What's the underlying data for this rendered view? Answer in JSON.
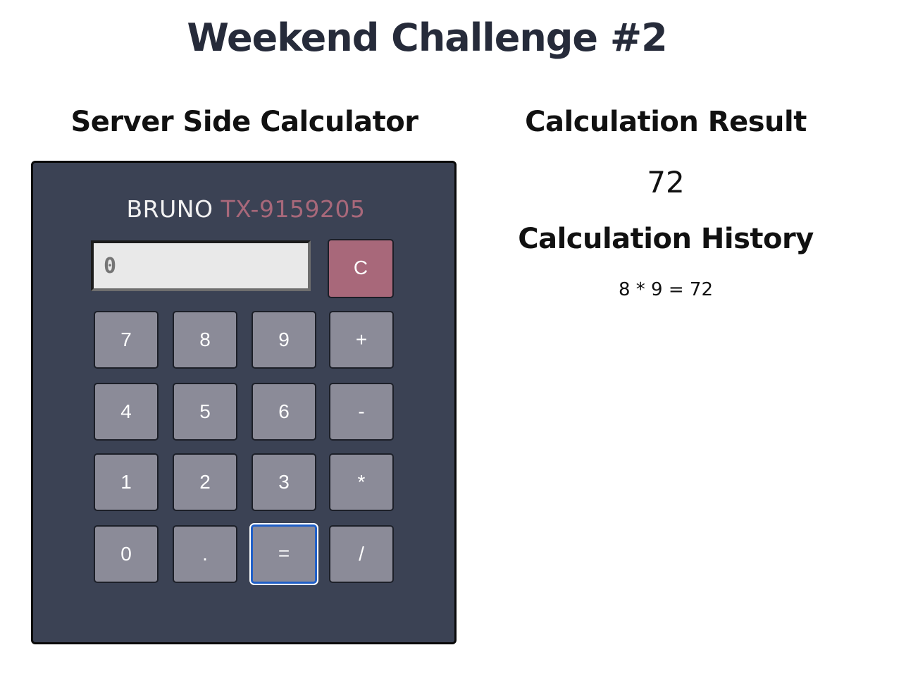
{
  "header": {
    "title": "Weekend Challenge #2"
  },
  "calculator": {
    "heading": "Server Side Calculator",
    "brand_name": "BRUNO",
    "brand_model": "TX-9159205",
    "display_placeholder": "0",
    "clear_label": "C",
    "keys": {
      "k7": "7",
      "k8": "8",
      "k9": "9",
      "add": "+",
      "k4": "4",
      "k5": "5",
      "k6": "6",
      "subtract": "-",
      "k1": "1",
      "k2": "2",
      "k3": "3",
      "multiply": "*",
      "k0": "0",
      "decimal": ".",
      "equals": "=",
      "divide": "/"
    }
  },
  "result": {
    "heading": "Calculation Result",
    "value": "72"
  },
  "history": {
    "heading": "Calculation History",
    "items": [
      "8 * 9 = 72"
    ]
  },
  "colors": {
    "calculator_body": "#3b4254",
    "key": "#8b8b98",
    "accent": "#a8687a",
    "focus": "#1f5fc8"
  }
}
